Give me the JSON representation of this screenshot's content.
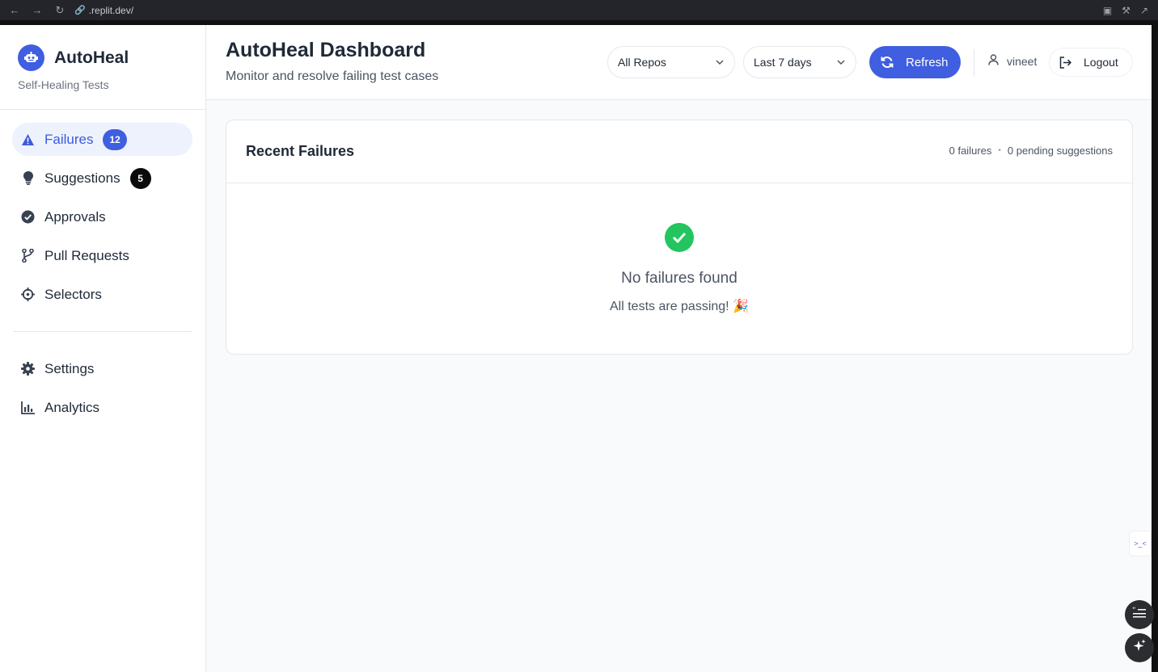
{
  "browser": {
    "url": ".replit.dev/"
  },
  "brand": {
    "title": "AutoHeal",
    "subtitle": "Self-Healing Tests"
  },
  "sidebar": {
    "items": [
      {
        "label": "Failures",
        "badge": "12",
        "icon": "warning-icon",
        "active": true
      },
      {
        "label": "Suggestions",
        "badge": "5",
        "icon": "lightbulb-icon"
      },
      {
        "label": "Approvals",
        "icon": "check-circle-icon"
      },
      {
        "label": "Pull Requests",
        "icon": "git-branch-icon"
      },
      {
        "label": "Selectors",
        "icon": "crosshair-icon"
      }
    ],
    "secondary": [
      {
        "label": "Settings",
        "icon": "gear-icon"
      },
      {
        "label": "Analytics",
        "icon": "bar-chart-icon"
      }
    ]
  },
  "header": {
    "title": "AutoHeal Dashboard",
    "subtitle": "Monitor and resolve failing test cases",
    "repo_select": "All Repos",
    "range_select": "Last 7 days",
    "refresh_label": "Refresh",
    "username": "vineet",
    "logout_label": "Logout"
  },
  "card": {
    "title": "Recent Failures",
    "failures_count": "0 failures",
    "pending_count": "0 pending suggestions",
    "empty_title": "No failures found",
    "empty_subtitle": "All tests are passing! 🎉"
  },
  "colors": {
    "accent": "#3f5ee0",
    "success": "#22c55e",
    "badge_dark": "#0b0b0c"
  }
}
